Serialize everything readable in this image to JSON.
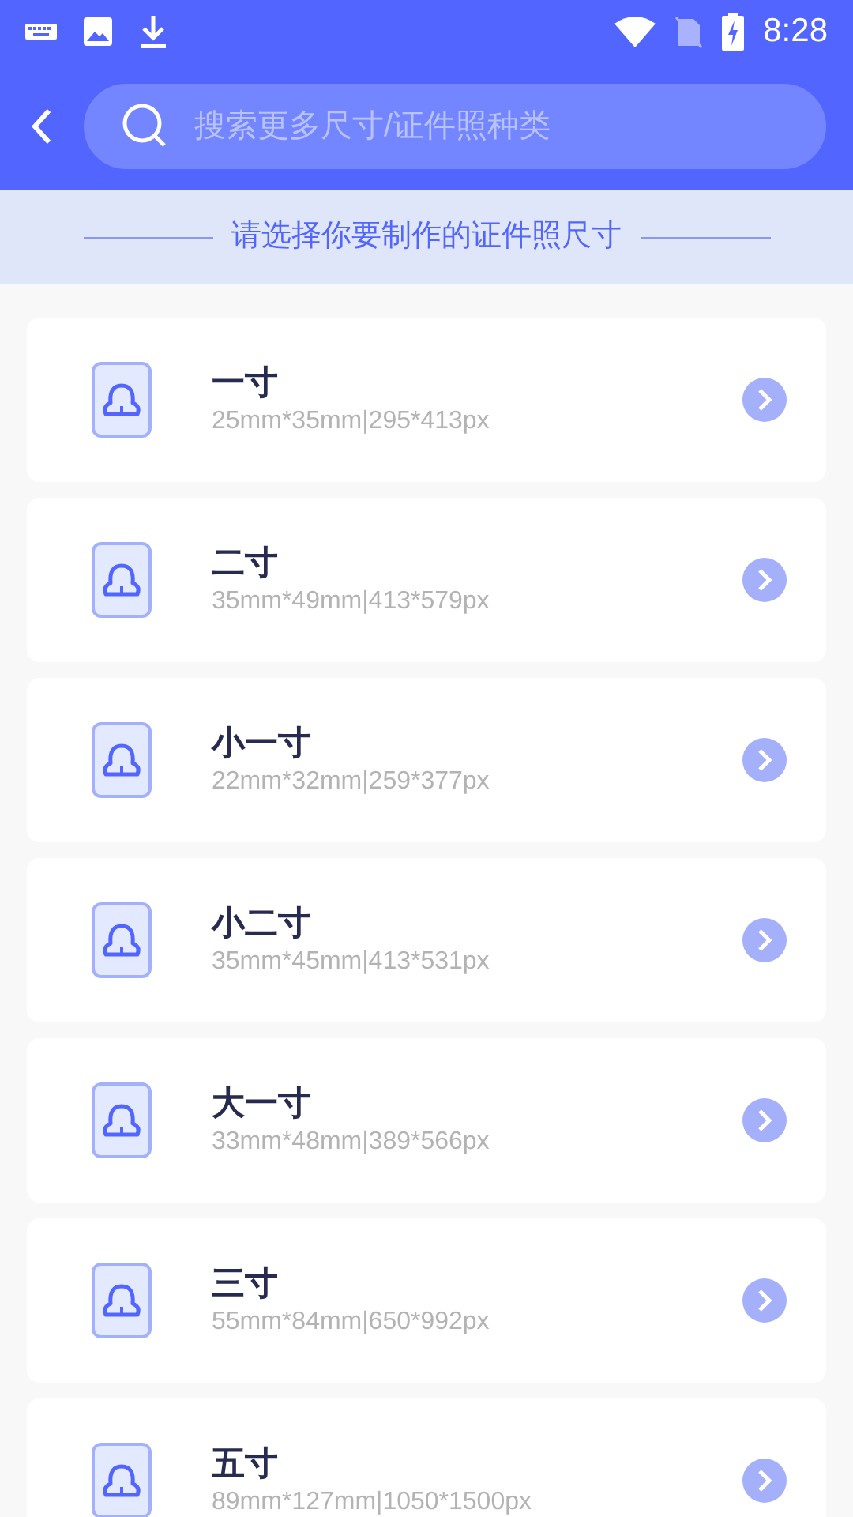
{
  "status_bar": {
    "time": "8:28"
  },
  "search": {
    "placeholder": "搜索更多尺寸/证件照种类"
  },
  "banner": "请选择你要制作的证件照尺寸",
  "sizes": [
    {
      "name": "一寸",
      "detail": "25mm*35mm|295*413px"
    },
    {
      "name": "二寸",
      "detail": "35mm*49mm|413*579px"
    },
    {
      "name": "小一寸",
      "detail": "22mm*32mm|259*377px"
    },
    {
      "name": "小二寸",
      "detail": "35mm*45mm|413*531px"
    },
    {
      "name": "大一寸",
      "detail": "33mm*48mm|389*566px"
    },
    {
      "name": "三寸",
      "detail": "55mm*84mm|650*992px"
    },
    {
      "name": "五寸",
      "detail": "89mm*127mm|1050*1500px"
    }
  ]
}
